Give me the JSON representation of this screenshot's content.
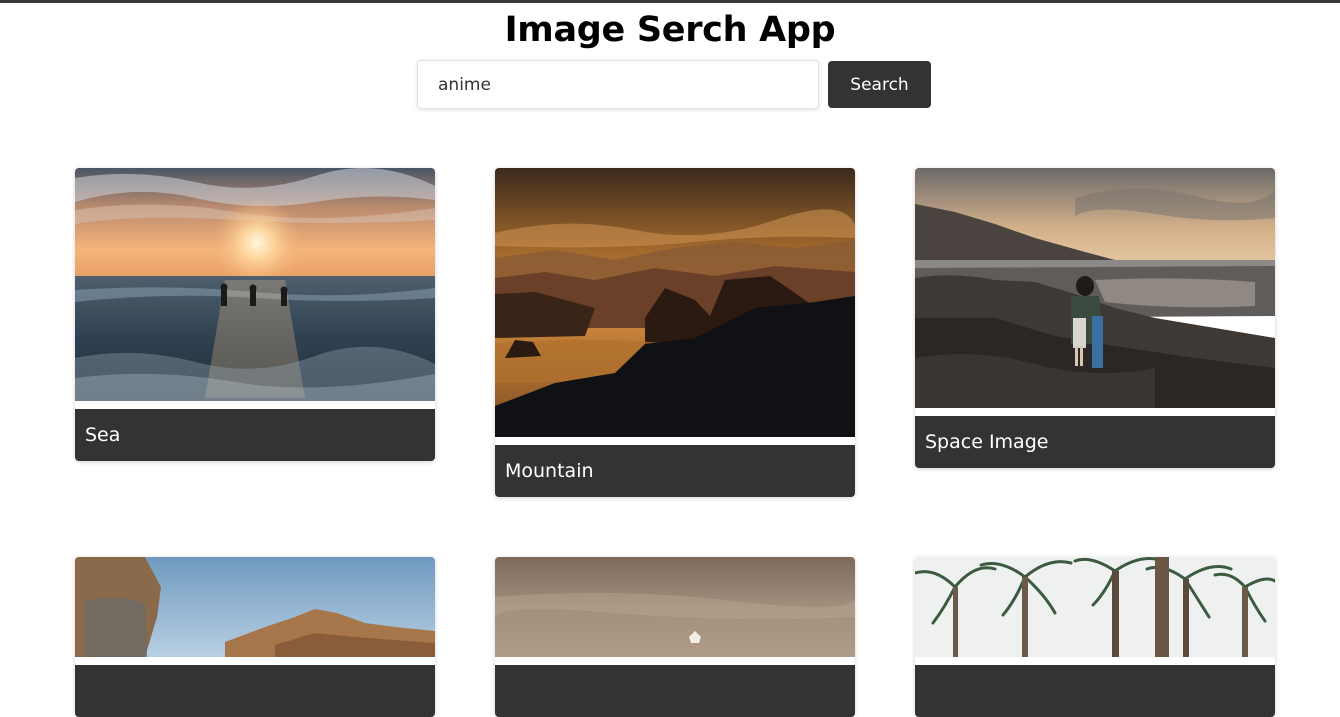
{
  "header": {
    "title": "Image Serch App"
  },
  "search": {
    "value": "anime",
    "button_label": "Search"
  },
  "cards": [
    {
      "caption": "Sea"
    },
    {
      "caption": "Mountain"
    },
    {
      "caption": "Space Image"
    },
    {
      "caption": ""
    },
    {
      "caption": ""
    },
    {
      "caption": ""
    }
  ]
}
